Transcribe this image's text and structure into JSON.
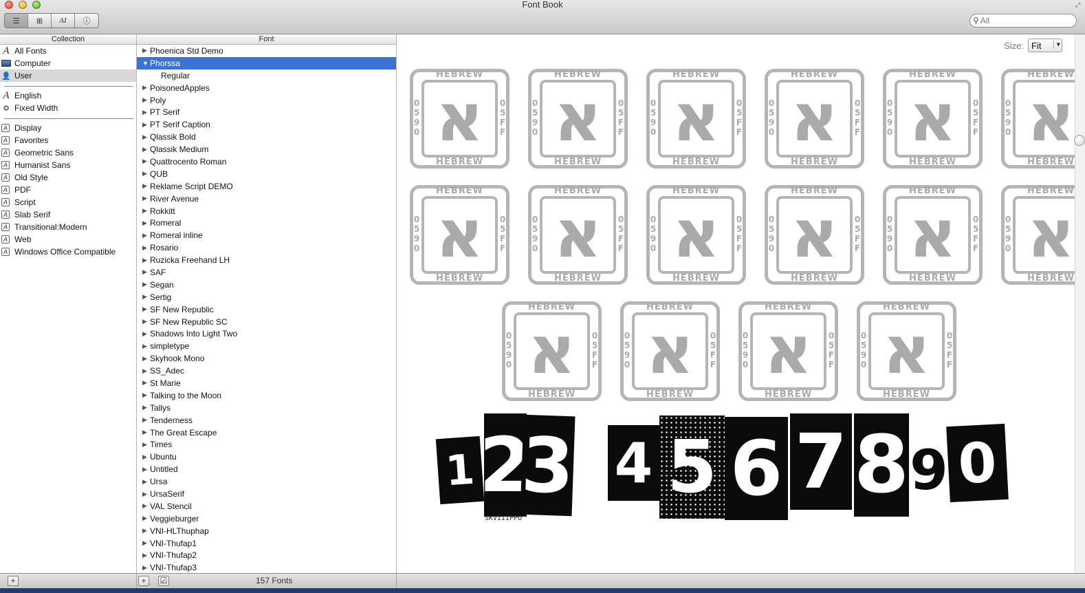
{
  "window": {
    "title": "Font Book"
  },
  "toolbar": {
    "views": [
      "☰",
      "⊞",
      "AI",
      "ⓘ"
    ],
    "search_placeholder": "All"
  },
  "columns": {
    "collection": "Collection",
    "font": "Font"
  },
  "collections": {
    "group1": [
      {
        "label": "All Fonts",
        "icon": "script-a-icon"
      },
      {
        "label": "Computer",
        "icon": "computer-icon"
      },
      {
        "label": "User",
        "icon": "user-icon",
        "selected": true
      }
    ],
    "group2": [
      {
        "label": "English",
        "icon": "script-a-icon"
      },
      {
        "label": "Fixed Width",
        "icon": "gear-icon"
      }
    ],
    "group3": [
      {
        "label": "Display"
      },
      {
        "label": "Favorites"
      },
      {
        "label": "Geometric Sans"
      },
      {
        "label": "Humanist Sans"
      },
      {
        "label": "Old Style"
      },
      {
        "label": "PDF"
      },
      {
        "label": "Script"
      },
      {
        "label": "Slab Serif"
      },
      {
        "label": "Transitional:Modern"
      },
      {
        "label": "Web"
      },
      {
        "label": "Windows Office Compatible"
      }
    ]
  },
  "fonts": [
    {
      "name": "Phoenica Std Demo"
    },
    {
      "name": "Phorssa",
      "expanded": true,
      "selected": true
    },
    {
      "name": "Regular",
      "child": true
    },
    {
      "name": "PoisonedApples"
    },
    {
      "name": "Poly"
    },
    {
      "name": "PT Serif"
    },
    {
      "name": "PT Serif Caption"
    },
    {
      "name": "Qlassik Bold"
    },
    {
      "name": "Qlassik Medium"
    },
    {
      "name": "Quattrocento Roman"
    },
    {
      "name": "QUB"
    },
    {
      "name": "Reklame Script DEMO"
    },
    {
      "name": "River Avenue"
    },
    {
      "name": "Rokkitt"
    },
    {
      "name": "Romeral"
    },
    {
      "name": "Romeral inline"
    },
    {
      "name": "Rosario"
    },
    {
      "name": "Ruzicka Freehand LH"
    },
    {
      "name": "SAF"
    },
    {
      "name": "Segan"
    },
    {
      "name": "Sertig"
    },
    {
      "name": "SF New Republic"
    },
    {
      "name": "SF New Republic SC"
    },
    {
      "name": "Shadows Into Light Two"
    },
    {
      "name": "simpletype"
    },
    {
      "name": "Skyhook Mono"
    },
    {
      "name": "SS_Adec"
    },
    {
      "name": "St Marie"
    },
    {
      "name": "Talking to the Moon"
    },
    {
      "name": "Tallys"
    },
    {
      "name": "Tenderness"
    },
    {
      "name": "The Great Escape"
    },
    {
      "name": "Times"
    },
    {
      "name": "Ubuntu"
    },
    {
      "name": "Untitled"
    },
    {
      "name": "Ursa"
    },
    {
      "name": "UrsaSerif"
    },
    {
      "name": "VAL Stencil"
    },
    {
      "name": "Veggieburger"
    },
    {
      "name": "VNI-HLThuphap"
    },
    {
      "name": "VNI-Thufap1"
    },
    {
      "name": "VNI-Thufap2"
    },
    {
      "name": "VNI-Thufap3"
    }
  ],
  "preview": {
    "size_label": "Size:",
    "size_value": "Fit",
    "glyph": {
      "letter": "א",
      "top": "HEBREW",
      "bottom": "HEBREW",
      "left": [
        "0",
        "5",
        "9",
        "0"
      ],
      "right": [
        "0",
        "5",
        "F",
        "F"
      ]
    },
    "digits": [
      "1",
      "2",
      "3",
      "4",
      "5",
      "6",
      "7",
      "8",
      "9",
      "0"
    ],
    "digit_captions": [
      "SKVIIIPPO"
    ]
  },
  "status": {
    "font_count": "157 Fonts"
  },
  "colors": {
    "selection": "#3a72d6",
    "glyph_gray": "#b5b5b5"
  }
}
